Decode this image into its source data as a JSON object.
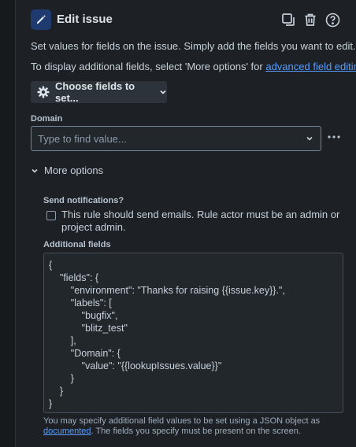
{
  "header": {
    "title": "Edit issue"
  },
  "intro": {
    "line1": "Set values for fields on the issue. Simply add the fields you want to edit.",
    "line2_prefix": "To display additional fields, select 'More options' for ",
    "line2_link": "advanced field editing",
    "line2_suffix": "."
  },
  "choose_fields": {
    "label": "Choose fields to set..."
  },
  "domain": {
    "label": "Domain",
    "placeholder": "Type to find value..."
  },
  "more_options": {
    "label": "More options"
  },
  "notifications": {
    "label": "Send notifications?",
    "checkbox_text": "This rule should send emails. Rule actor must be an admin or project admin.",
    "checked": false
  },
  "additional_fields": {
    "label": "Additional fields",
    "json": "{\n    \"fields\": {\n        \"environment\": \"Thanks for raising {{issue.key}}.\",\n        \"labels\": [\n            \"bugfix\",\n            \"blitz_test\"\n        ],\n        \"Domain\": {\n            \"value\": \"{{lookupIssues.value}}\"\n        }\n    }\n}",
    "helper_prefix": "You may specify additional field values to be set using a JSON object as ",
    "helper_link": "documented",
    "helper_suffix": ". The fields you specify must be present on the screen."
  },
  "colors": {
    "background": "#1d2125",
    "accent_link": "#579dff",
    "icon_box": "#1e3a6e"
  }
}
